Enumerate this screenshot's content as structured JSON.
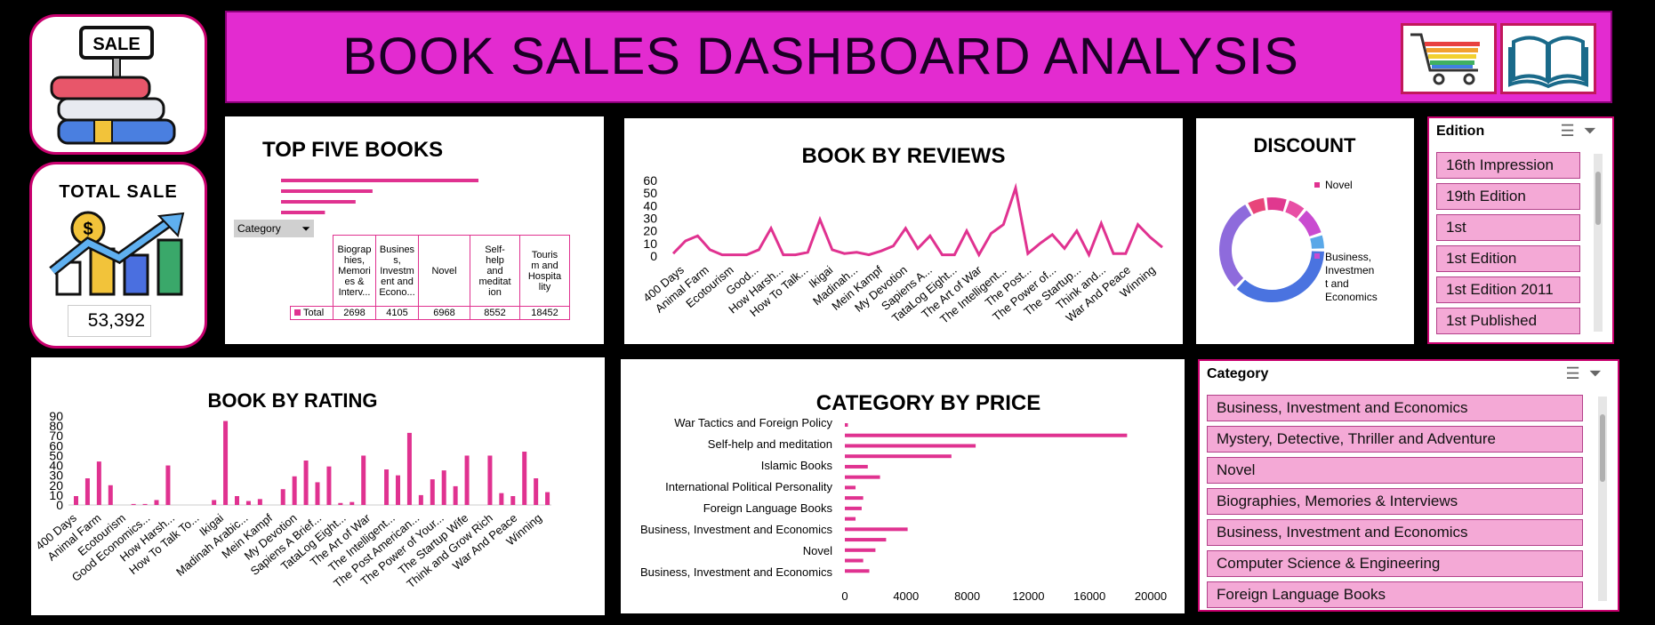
{
  "header": {
    "title": "BOOK SALES DASHBOARD ANALYSIS",
    "icons": [
      "shopping-cart-icon",
      "open-book-icon"
    ]
  },
  "logo": {
    "sign_text": "SALE",
    "icon": "books-sale-icon"
  },
  "total_sale": {
    "title": "TOTAL  SALE",
    "value": "53,392",
    "icon": "growth-chart-icon"
  },
  "colors": {
    "accent": "#e03290",
    "header_bg": "#e32bd0",
    "slicer_item": "#f4a9d6"
  },
  "top_five": {
    "title": "TOP FIVE BOOKS",
    "filter_label": "Category",
    "columns": [
      "Biographies, Memories & Interv...",
      "Business, Investment and Econo...",
      "Novel",
      "Self-help and meditation",
      "Tourism and Hospitality"
    ],
    "column_lines": [
      [
        "Biograp",
        "hies,",
        "Memori",
        "es &",
        "Interv..."
      ],
      [
        "Busines",
        "s,",
        "Investm",
        "ent and",
        "Econo..."
      ],
      [
        "Novel"
      ],
      [
        "Self-",
        "help",
        "and",
        "meditat",
        "ion"
      ],
      [
        "Touris",
        "m and",
        "Hospita",
        "lity"
      ]
    ],
    "row_label": "Total",
    "values": [
      "2698",
      "4105",
      "6968",
      "8552",
      "18452"
    ]
  },
  "chart_data": [
    {
      "type": "bar",
      "orientation": "horizontal",
      "title": "",
      "categories": [
        "Biographies, Memories & Interv...",
        "Business, Investment and Econo...",
        "Novel",
        "Self-help and meditation",
        "Tourism and Hospitality"
      ],
      "values": [
        2698,
        4105,
        6968,
        8552,
        18452
      ]
    },
    {
      "type": "line",
      "title": "BOOK BY REVIEWS",
      "ylim": [
        0,
        60
      ],
      "yticks": [
        0,
        10,
        20,
        30,
        40,
        50,
        60
      ],
      "x_labels": [
        "400 Days",
        "Animal Farm",
        "Ecotourism",
        "Good...",
        "How Harsh...",
        "How To Talk...",
        "Ikigai",
        "Madinah...",
        "Mein Kampf",
        "My Devotion",
        "Sapiens A...",
        "TataLog Eight...",
        "The Art of War",
        "The Intelligent...",
        "The Post...",
        "The Power of...",
        "The Startup...",
        "Think and...",
        "War And Peace",
        "Winning"
      ],
      "values": [
        2,
        12,
        16,
        5,
        1,
        1,
        1,
        5,
        22,
        1,
        1,
        3,
        29,
        5,
        2,
        3,
        1,
        4,
        8,
        22,
        6,
        16,
        1,
        1,
        20,
        1,
        18,
        25,
        54,
        2,
        10,
        17,
        6,
        20,
        1,
        26,
        2,
        2,
        25,
        15,
        7
      ]
    },
    {
      "type": "pie",
      "donut": true,
      "title": "DISCOUNT",
      "legend": [
        "Novel",
        "Business, Investment and Economics"
      ],
      "legend_lines": [
        [
          "Novel"
        ],
        [
          "Business,",
          "Investmen",
          "t and",
          "Economics"
        ]
      ],
      "values": [
        6,
        7,
        6,
        9,
        5,
        37,
        30
      ],
      "colors": [
        "#e8457a",
        "#e0388f",
        "#e84fa5",
        "#c94bd0",
        "#5aa8e8",
        "#4a73e0",
        "#8e6bdc"
      ]
    },
    {
      "type": "bar",
      "title": "BOOK BY RATING",
      "ylim": [
        0,
        90
      ],
      "yticks": [
        0,
        10,
        20,
        30,
        40,
        50,
        60,
        70,
        80,
        90
      ],
      "x_labels": [
        "400 Days",
        "Animal Farm",
        "Ecotourism",
        "Good Economics...",
        "How Harsh...",
        "How To Talk To...",
        "Ikigai",
        "Madinah Arabic...",
        "Mein Kampf",
        "My Devotion",
        "Sapiens A Brief...",
        "TataLog Eight...",
        "The Art of War",
        "The Intelligent...",
        "The Post American...",
        "The Power of Your...",
        "The Startup Wife",
        "Think and Grow Rich",
        "War And Peace",
        "Winning"
      ],
      "values": [
        9,
        27,
        44,
        20,
        0,
        1,
        1,
        5,
        40,
        0,
        0,
        0,
        5,
        85,
        9,
        4,
        6,
        0,
        16,
        29,
        45,
        23,
        39,
        2,
        3,
        50,
        0,
        36,
        30,
        73,
        10,
        26,
        35,
        19,
        50,
        0,
        50,
        12,
        9,
        54,
        27,
        13
      ]
    },
    {
      "type": "bar",
      "orientation": "horizontal",
      "title": "CATEGORY BY PRICE",
      "xlim": [
        0,
        20000
      ],
      "xticks": [
        0,
        4000,
        8000,
        12000,
        16000,
        20000
      ],
      "y_labels": [
        "War Tactics and Foreign Policy",
        "Self-help and meditation",
        "Islamic Books",
        "International Political Personality",
        "Foreign Language Books",
        "Business, Investment and Economics",
        "Novel",
        "Business, Investment and Economics"
      ],
      "values": [
        200,
        18452,
        8552,
        6968,
        1500,
        2300,
        700,
        1200,
        1100,
        700,
        4105,
        2698,
        2000,
        1200,
        1600
      ]
    }
  ],
  "edition_slicer": {
    "title": "Edition",
    "items": [
      "16th Impression",
      "19th Edition",
      "1st",
      "1st Edition",
      "1st Edition 2011",
      "1st Published"
    ]
  },
  "category_slicer": {
    "title": "Category",
    "items": [
      "Business, Investment and Economics",
      "Mystery, Detective, Thriller and Adventure",
      "Novel",
      "Biographies, Memories & Interviews",
      "Business, Investment and Economics",
      "Computer Science & Engineering",
      "Foreign Language Books"
    ]
  }
}
